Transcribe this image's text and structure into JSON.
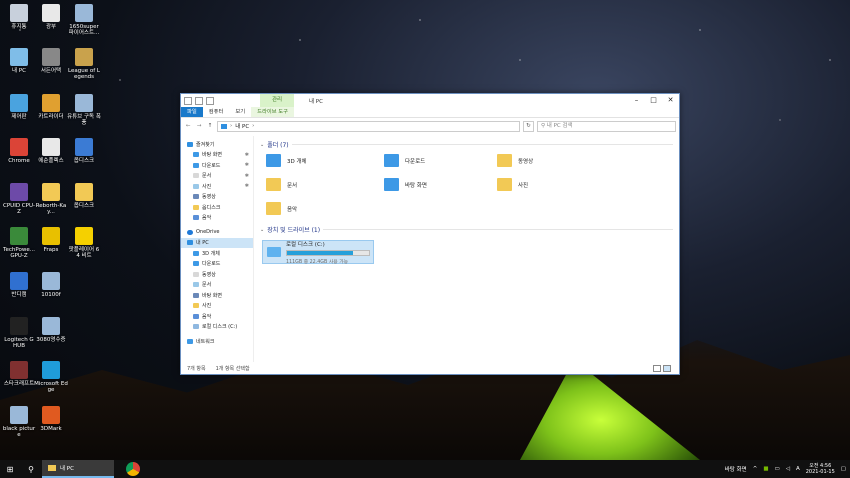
{
  "desktop": {
    "icons": [
      {
        "label": "휴지통",
        "name": "recycle-bin-icon",
        "color": "#c8d0dc"
      },
      {
        "label": "광부",
        "name": "miner-icon",
        "color": "#e8e8e8"
      },
      {
        "label": "1650super 파이어스트...",
        "name": "image-file-icon",
        "color": "#9ab8d8"
      },
      {
        "label": "내 PC",
        "name": "this-pc-icon",
        "color": "#7fbde8"
      },
      {
        "label": "서든어택",
        "name": "sudden-attack-icon",
        "color": "#888888"
      },
      {
        "label": "League of Legends",
        "name": "league-of-legends-icon",
        "color": "#c9a24c"
      },
      {
        "label": "제어판",
        "name": "control-panel-icon",
        "color": "#4aa3df"
      },
      {
        "label": "카트라이더",
        "name": "kartrider-icon",
        "color": "#e0a030"
      },
      {
        "label": "유튜브 구독 폭풍",
        "name": "image-file-icon",
        "color": "#9ab8d8"
      },
      {
        "label": "Chrome",
        "name": "chrome-icon",
        "color": "#db4437"
      },
      {
        "label": "에순플렉스",
        "name": "app-icon",
        "color": "#e8e8e8"
      },
      {
        "label": "옵디스크",
        "name": "app-icon",
        "color": "#3b7bd4"
      },
      {
        "label": "CPUID CPU-Z",
        "name": "cpuz-icon",
        "color": "#6d4aa8"
      },
      {
        "label": "Reborth-Kay...",
        "name": "folder-icon",
        "color": "#f2c955"
      },
      {
        "label": "옵디스크",
        "name": "folder-icon",
        "color": "#f2c955"
      },
      {
        "label": "TechPowe... GPU-Z",
        "name": "gpuz-icon",
        "color": "#3a8a3a"
      },
      {
        "label": "Fraps",
        "name": "fraps-icon",
        "color": "#e8c000"
      },
      {
        "label": "팟플레이어 64 비트",
        "name": "potplayer-icon",
        "color": "#f5d000"
      },
      {
        "label": "반디캠",
        "name": "bandicam-icon",
        "color": "#3070d0"
      },
      {
        "label": "10100f",
        "name": "image-file-icon",
        "color": "#9ab8d8"
      },
      {
        "label": "Logitech G HUB",
        "name": "logitech-icon",
        "color": "#222222"
      },
      {
        "label": "3080영수증",
        "name": "image-file-icon",
        "color": "#9ab8d8"
      },
      {
        "label": "스타크래프트",
        "name": "starcraft-icon",
        "color": "#803030"
      },
      {
        "label": "Microsoft Edge",
        "name": "edge-icon",
        "color": "#1f9cda"
      },
      {
        "label": "black picture",
        "name": "image-file-icon",
        "color": "#9ab8d8"
      },
      {
        "label": "3DMark",
        "name": "3dmark-icon",
        "color": "#e05a20"
      }
    ]
  },
  "window": {
    "title": "내 PC",
    "context_tab": "관리",
    "ribbon_tabs": [
      "파일",
      "컴퓨터",
      "보기",
      "드라이브 도구"
    ],
    "address": {
      "back": "←",
      "forward": "→",
      "up": "↑",
      "path": "내 PC",
      "separator": "›",
      "search_placeholder": "내 PC 검색"
    },
    "sidebar": {
      "quick_access": "즐겨찾기",
      "quick_items": [
        "바탕 화면",
        "다운로드",
        "문서",
        "사진",
        "동영상",
        "옵디스크",
        "음악"
      ],
      "onedrive": "OneDrive",
      "this_pc": "내 PC",
      "pc_items": [
        "3D 개체",
        "다운로드",
        "동영상",
        "문서",
        "바탕 화면",
        "사진",
        "음악",
        "로컬 디스크 (C:)"
      ],
      "network": "네트워크"
    },
    "folders_header": "폴더 (7)",
    "folders": [
      "3D 개체",
      "다운로드",
      "동영상",
      "문서",
      "바탕 화면",
      "사진",
      "음악"
    ],
    "devices_header": "장치 및 드라이브 (1)",
    "drive": {
      "name": "로컬 디스크 (C:)",
      "capacity": "111GB 중 22.4GB 사용 가능",
      "used_fraction": 0.8
    },
    "status": {
      "items": "7개 항목",
      "selected": "1개 항목 선택함"
    }
  },
  "taskbar": {
    "active_app": "내 PC",
    "tray_label": "바탕 화면",
    "ime": "A",
    "time": "오전 4:56",
    "date": "2021-01-15"
  },
  "colors": {
    "accent": "#1979ca",
    "selection": "#cce4f7",
    "folder": "#f2c955",
    "drive_bar": "#26a0da",
    "tent_glow": "#c8ff3a"
  }
}
